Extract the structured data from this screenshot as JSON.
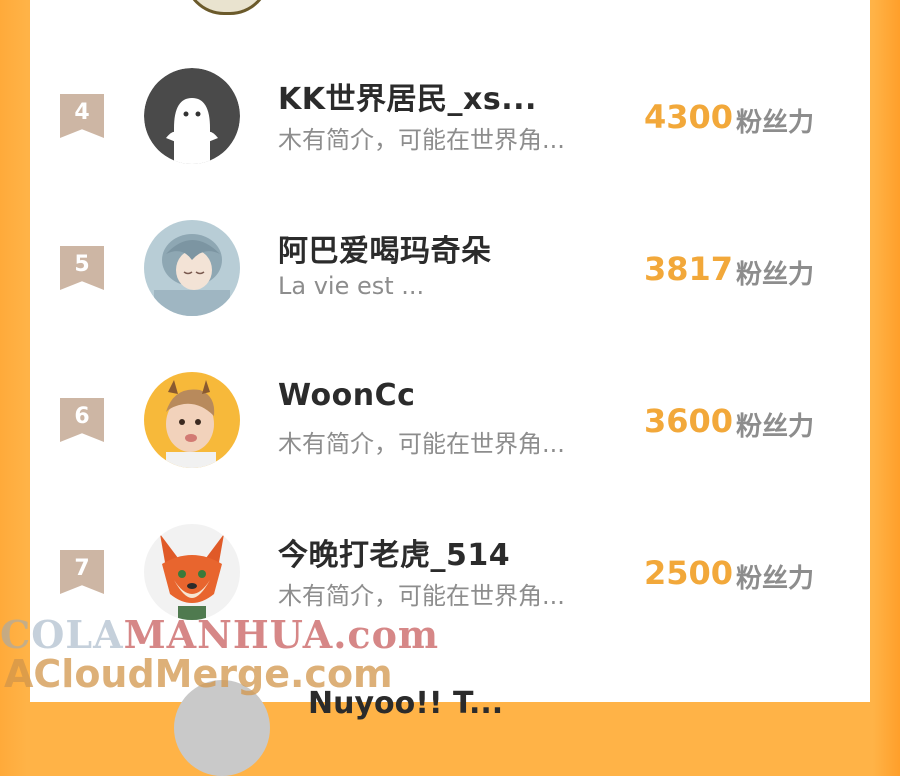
{
  "unit_label": "粉丝力",
  "rows": [
    {
      "rank": "4",
      "name": "KK世界居民_xs...",
      "bio": "木有简介，可能在世界角...",
      "score": "4300",
      "avatar_icon": "ghost-avatar-icon"
    },
    {
      "rank": "5",
      "name": "阿巴爱喝玛奇朵",
      "bio": "La vie est ...",
      "score": "3817",
      "avatar_icon": "anime-avatar-icon"
    },
    {
      "rank": "6",
      "name": "WoonCc",
      "bio": "木有简介，可能在世界角...",
      "score": "3600",
      "avatar_icon": "child-avatar-icon"
    },
    {
      "rank": "7",
      "name": "今晚打老虎_514",
      "bio": "木有简介，可能在世界角...",
      "score": "2500",
      "avatar_icon": "fox-avatar-icon"
    }
  ],
  "partial_row": {
    "name": "Nuyoo!! T..."
  },
  "watermark": {
    "line1_a": "COLA",
    "line1_b": "MANHUA.com",
    "line2": "ACloudMerge.com"
  },
  "colors": {
    "accent": "#f2a83a",
    "badge": "#cdb6a4",
    "background": "#ffb347"
  }
}
